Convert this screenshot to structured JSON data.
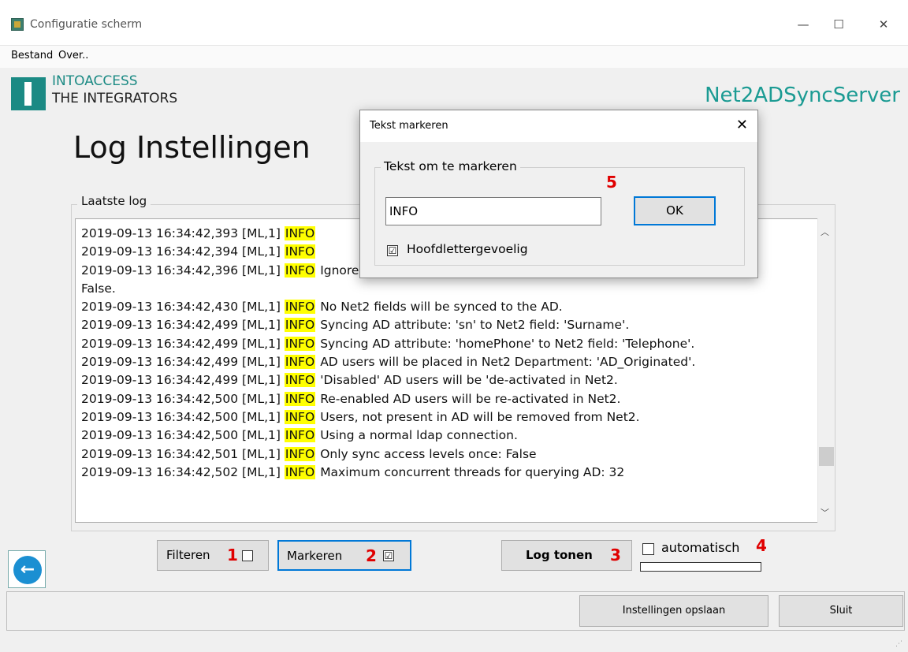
{
  "window": {
    "title": "Configuratie scherm",
    "minimize": "—",
    "maximize": "☐",
    "close": "✕"
  },
  "menu": [
    "Bestand",
    "Over.."
  ],
  "logo": {
    "line1": "INTOACCESS",
    "line2": "THE INTEGRATORS"
  },
  "product": "Net2ADSyncServer",
  "page_title": "Log Instellingen",
  "log": {
    "group_label": "Laatste log",
    "lines": [
      {
        "ts": "2019-09-13 16:34:42,393 [ML,1]",
        "lvl": "INFO",
        "msg": ""
      },
      {
        "ts": "2019-09-13 16:34:42,394 [ML,1]",
        "lvl": "INFO",
        "msg": ""
      },
      {
        "ts": "2019-09-13 16:34:42,396 [ML,1]",
        "lvl": "INFO",
        "msg": "Ignore the users Net2 Department after the initial placement:"
      },
      {
        "ts": "False.",
        "lvl": "",
        "msg": ""
      },
      {
        "ts": "2019-09-13 16:34:42,430 [ML,1]",
        "lvl": "INFO",
        "msg": "No Net2 fields will be synced to the AD."
      },
      {
        "ts": "2019-09-13 16:34:42,499 [ML,1]",
        "lvl": "INFO",
        "msg": "Syncing AD attribute: 'sn' to Net2 field: 'Surname'."
      },
      {
        "ts": "2019-09-13 16:34:42,499 [ML,1]",
        "lvl": "INFO",
        "msg": "Syncing AD attribute: 'homePhone' to Net2 field: 'Telephone'."
      },
      {
        "ts": "2019-09-13 16:34:42,499 [ML,1]",
        "lvl": "INFO",
        "msg": "AD users will be placed in Net2 Department: 'AD_Originated'."
      },
      {
        "ts": "2019-09-13 16:34:42,499 [ML,1]",
        "lvl": "INFO",
        "msg": "'Disabled' AD users will be 'de-activated in Net2."
      },
      {
        "ts": "2019-09-13 16:34:42,500 [ML,1]",
        "lvl": "INFO",
        "msg": "Re-enabled AD users will be re-activated in Net2."
      },
      {
        "ts": "2019-09-13 16:34:42,500 [ML,1]",
        "lvl": "INFO",
        "msg": "Users, not present in AD will be removed from Net2."
      },
      {
        "ts": "2019-09-13 16:34:42,500 [ML,1]",
        "lvl": "INFO",
        "msg": "Using a normal ldap connection."
      },
      {
        "ts": "2019-09-13 16:34:42,501 [ML,1]",
        "lvl": "INFO",
        "msg": "Only sync access levels once: False"
      },
      {
        "ts": "2019-09-13 16:34:42,502 [ML,1]",
        "lvl": "INFO",
        "msg": "Maximum concurrent threads for querying AD: 32"
      }
    ]
  },
  "controls": {
    "filter_label": "Filteren",
    "filter_num": "1",
    "marker_label": "Markeren",
    "marker_num": "2",
    "marker_checked": "☑",
    "log_label": "Log tonen",
    "log_num": "3",
    "auto_label": "automatisch",
    "auto_num": "4"
  },
  "footer": {
    "save_label": "Instellingen opslaan",
    "close_label": "Sluit"
  },
  "dialog": {
    "title": "Tekst markeren",
    "close": "✕",
    "group_label": "Tekst om te markeren",
    "num": "5",
    "input_value": "INFO",
    "ok_label": "OK",
    "case_checked": "☑",
    "case_label": "Hoofdlettergevoelig"
  },
  "icons": {
    "back": "arrow-left-icon",
    "scroll_up": "chevron-up-icon",
    "scroll_down": "chevron-down-icon"
  },
  "colors": {
    "highlight": "#ffff00",
    "brand": "#1b8a84",
    "accent": "#0078d7",
    "annotation": "#e00000"
  }
}
